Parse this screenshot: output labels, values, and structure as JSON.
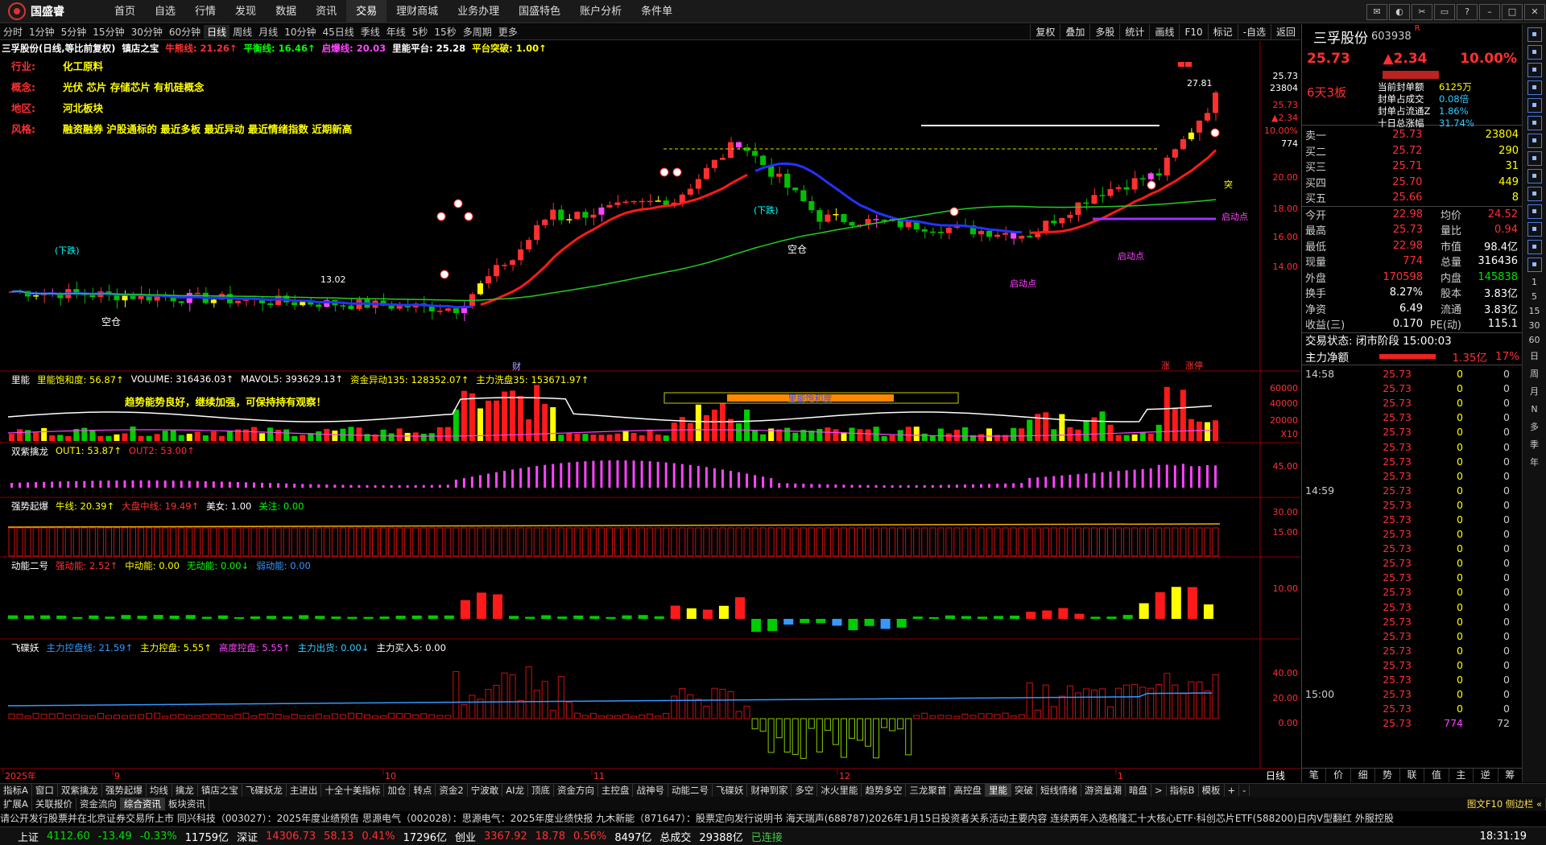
{
  "app": {
    "brand": "国盛睿",
    "menu": [
      "首页",
      "自选",
      "行情",
      "发现",
      "数据",
      "资讯",
      "交易",
      "理财商城",
      "业务办理",
      "国盛特色",
      "账户分析",
      "条件单"
    ],
    "active_menu": "交易"
  },
  "periods": [
    "分时",
    "1分钟",
    "5分钟",
    "15分钟",
    "30分钟",
    "60分钟",
    "日线",
    "周线",
    "月线",
    "10分钟",
    "45日线",
    "季线",
    "年线",
    "5秒",
    "15秒",
    "多周期",
    "更多"
  ],
  "active_period": "日线",
  "right_tools": [
    "复权",
    "叠加",
    "多股",
    "统计",
    "画线",
    "F10",
    "标记",
    "-自选",
    "返回"
  ],
  "chart": {
    "header": [
      {
        "text": "三孚股份(日线,等比前复权)",
        "color": "#ffffff"
      },
      {
        "text": "镇店之宝",
        "color": "#ffffff"
      },
      {
        "text": "牛熊线: 21.26↑",
        "color": "#ff3030"
      },
      {
        "text": "平衡线: 16.46↑",
        "color": "#00ff00"
      },
      {
        "text": "启爆线: 20.03",
        "color": "#ff44ff"
      },
      {
        "text": "里能平台: 25.28",
        "color": "#ffffff"
      },
      {
        "text": "平台突破: 1.00↑",
        "color": "#ffff00"
      }
    ],
    "info": [
      {
        "label": "行业:",
        "value": "化工原料"
      },
      {
        "label": "概念:",
        "value": "光伏 芯片 存储芯片 有机硅概念"
      },
      {
        "label": "地区:",
        "value": "河北板块"
      },
      {
        "label": "风格:",
        "value": "融资融券 沪股通标的 最近多板 最近异动 最近情绪指数 近期新高"
      }
    ],
    "price_axis": [
      "25.73",
      "23804",
      "25.73",
      "▲2.34",
      "10.00%",
      "774",
      "20.00",
      "18.00",
      "16.00",
      "14.00"
    ],
    "annotations": {
      "high": "27.81",
      "low": "13.02",
      "xiadie1": "(下跌)",
      "xiadie2": "(下跌)",
      "kongcang1": "空仓",
      "kongcang2": "空仓",
      "qidongdian": "启动点",
      "tu": "突",
      "cai": "财",
      "zhang": "涨",
      "zhangting": "涨停"
    },
    "panels": [
      {
        "title": "里能",
        "items": [
          {
            "text": "里能饱和度: 56.87↑",
            "color": "#ffff00"
          },
          {
            "text": "VOLUME: 316436.03↑",
            "color": "#ffffff"
          },
          {
            "text": "MAVOL5: 393629.13↑",
            "color": "#ffffff"
          },
          {
            "text": "资金异动135: 128352.07↑",
            "color": "#ffff00"
          },
          {
            "text": "主力洗盘35: 153671.97↑",
            "color": "#ffff00"
          }
        ],
        "axis": [
          "60000",
          "40000",
          "20000",
          "X10"
        ],
        "note": "趋势能势良好，继续加强，可保持持有观察！",
        "box": "里能饱和度"
      },
      {
        "title": "双紫擒龙",
        "items": [
          {
            "text": "OUT1: 53.87↑",
            "color": "#ffff00"
          },
          {
            "text": "OUT2: 53.00↑",
            "color": "#ff3030"
          }
        ],
        "axis": [
          "45.00"
        ]
      },
      {
        "title": "强势起爆",
        "items": [
          {
            "text": "牛线: 20.39↑",
            "color": "#ffff00"
          },
          {
            "text": "大盘中线: 19.49↑",
            "color": "#ff3030"
          },
          {
            "text": "美女: 1.00",
            "color": "#ffffff"
          },
          {
            "text": "关注: 0.00",
            "color": "#00ff00"
          }
        ],
        "axis": [
          "30.00",
          "15.00"
        ]
      },
      {
        "title": "动能二号",
        "items": [
          {
            "text": "强动能: 2.52↑",
            "color": "#ff3030"
          },
          {
            "text": "中动能: 0.00",
            "color": "#ffff00"
          },
          {
            "text": "无动能: 0.00↓",
            "color": "#00ff00"
          },
          {
            "text": "弱动能: 0.00",
            "color": "#3399ff"
          }
        ],
        "axis": [
          "10.00"
        ]
      },
      {
        "title": "飞碟妖",
        "items": [
          {
            "text": "主力控盘线: 21.59↑",
            "color": "#3399ff"
          },
          {
            "text": "主力控盘: 5.55↑",
            "color": "#ffff00"
          },
          {
            "text": "高度控盘: 5.55↑",
            "color": "#ff44ff"
          },
          {
            "text": "主力出货: 0.00↓",
            "color": "#33ccff"
          },
          {
            "text": "主力买入5: 0.00",
            "color": "#ffffff"
          }
        ],
        "axis": [
          "40.00",
          "20.00",
          "0.00"
        ]
      }
    ],
    "dates": [
      "2025年",
      "9",
      "10",
      "11",
      "12",
      "1"
    ],
    "period_label": "日线"
  },
  "quote": {
    "name": "三孚股份",
    "code": "603938",
    "mark": "R",
    "price": "25.73",
    "change": "▲2.34",
    "pct": "10.00%",
    "limit_label": "6天3板",
    "seal": [
      {
        "k": "当前封单额",
        "v": "6125万"
      },
      {
        "k": "封单占成交",
        "v": "0.08倍"
      },
      {
        "k": "封单占流通Z",
        "v": "1.86%"
      },
      {
        "k": "十日总涨幅",
        "v": "31.74%"
      }
    ],
    "book": [
      {
        "k": "卖一",
        "p": "25.73",
        "v": "23804"
      },
      {
        "k": "买二",
        "p": "25.72",
        "v": "290"
      },
      {
        "k": "买三",
        "p": "25.71",
        "v": "31"
      },
      {
        "k": "买四",
        "p": "25.70",
        "v": "449"
      },
      {
        "k": "买五",
        "p": "25.66",
        "v": "8"
      }
    ],
    "stats": [
      {
        "a": "今开",
        "b": "22.98",
        "c": "均价",
        "d": "24.52"
      },
      {
        "a": "最高",
        "b": "25.73",
        "c": "量比",
        "d": "0.94"
      },
      {
        "a": "最低",
        "b": "22.98",
        "c": "市值",
        "d": "98.4亿"
      },
      {
        "a": "现量",
        "b": "774",
        "c": "总量",
        "d": "316436"
      },
      {
        "a": "外盘",
        "b": "170598",
        "c": "内盘",
        "d": "145838"
      },
      {
        "a": "换手",
        "b": "8.27%",
        "c": "股本",
        "d": "3.83亿"
      },
      {
        "a": "净资",
        "b": "6.49",
        "c": "流通",
        "d": "3.83亿"
      },
      {
        "a": "收益(三)",
        "b": "0.170",
        "c": "PE(动)",
        "d": "115.1"
      }
    ],
    "trade_status": "交易状态: 闭市阶段 15:00:03",
    "main_flow_label": "主力净额",
    "main_flow_value": "1.35亿",
    "main_flow_pct": "17%",
    "ticks": [
      {
        "t": "14:58",
        "p": "25.73",
        "v": "0",
        "n": "0"
      },
      {
        "t": "",
        "p": "25.73",
        "v": "0",
        "n": "0"
      },
      {
        "t": "",
        "p": "25.73",
        "v": "0",
        "n": "0"
      },
      {
        "t": "",
        "p": "25.73",
        "v": "0",
        "n": "0"
      },
      {
        "t": "",
        "p": "25.73",
        "v": "0",
        "n": "0"
      },
      {
        "t": "",
        "p": "25.73",
        "v": "0",
        "n": "0"
      },
      {
        "t": "",
        "p": "25.73",
        "v": "0",
        "n": "0"
      },
      {
        "t": "",
        "p": "25.73",
        "v": "0",
        "n": "0"
      },
      {
        "t": "14:59",
        "p": "25.73",
        "v": "0",
        "n": "0"
      },
      {
        "t": "",
        "p": "25.73",
        "v": "0",
        "n": "0"
      },
      {
        "t": "",
        "p": "25.73",
        "v": "0",
        "n": "0"
      },
      {
        "t": "",
        "p": "25.73",
        "v": "0",
        "n": "0"
      },
      {
        "t": "",
        "p": "25.73",
        "v": "0",
        "n": "0"
      },
      {
        "t": "",
        "p": "25.73",
        "v": "0",
        "n": "0"
      },
      {
        "t": "",
        "p": "25.73",
        "v": "0",
        "n": "0"
      },
      {
        "t": "",
        "p": "25.73",
        "v": "0",
        "n": "0"
      },
      {
        "t": "",
        "p": "25.73",
        "v": "0",
        "n": "0"
      },
      {
        "t": "",
        "p": "25.73",
        "v": "0",
        "n": "0"
      },
      {
        "t": "",
        "p": "25.73",
        "v": "0",
        "n": "0"
      },
      {
        "t": "",
        "p": "25.73",
        "v": "0",
        "n": "0"
      },
      {
        "t": "",
        "p": "25.73",
        "v": "0",
        "n": "0"
      },
      {
        "t": "",
        "p": "25.73",
        "v": "0",
        "n": "0"
      },
      {
        "t": "15:00",
        "p": "25.73",
        "v": "0",
        "n": "0"
      },
      {
        "t": "",
        "p": "25.73",
        "v": "0",
        "n": "0"
      },
      {
        "t": "",
        "p": "25.73",
        "v": "774",
        "n": "72"
      }
    ],
    "bottom_tabs": [
      "笔",
      "价",
      "细",
      "势",
      "联",
      "值",
      "主",
      "逆",
      "筹"
    ]
  },
  "side": [
    "日",
    "周",
    "月",
    "N",
    "多",
    "季",
    "年"
  ],
  "side_nums": [
    "1",
    "5",
    "15",
    "30",
    "60"
  ],
  "tabs": [
    "指标A",
    "窗口",
    "双紫擒龙",
    "强势起爆",
    "均线",
    "擒龙",
    "镇店之宝",
    "飞碟妖龙",
    "主进出",
    "十全十美指标",
    "加仓",
    "转点",
    "资金2",
    "宁波敢",
    "AI龙",
    "顶底",
    "资金方向",
    "主控盘",
    "战神号",
    "动能二号",
    "飞碟妖",
    "财神到家",
    "多空",
    "冰火里能",
    "趋势多空",
    "三龙聚首",
    "高控盘",
    "里能",
    "突破",
    "短线情绪",
    "游资量潮",
    "暗盘",
    ">",
    "指标B",
    "模板",
    "+",
    "-"
  ],
  "active_tab": "里能",
  "subtabs": [
    "扩展A",
    "关联报价",
    "资金流向",
    "综合资讯",
    "板块资讯"
  ],
  "subtab_right": "图文F10 侧边栏 «",
  "ticker": "请公开发行股票并在北京证券交易所上市    同兴科技（003027）：2025年度业绩预告    思源电气（002028）：思源电气：2025年度业绩快报    九木新能（871647）：股票定向发行说明书    海天瑞声(688787)2026年1月15日投资者关系活动主要内容    连续两年入选格隆汇十大核心ETF·科创芯片ETF(588200)日内V型翻红    外服控股",
  "status": {
    "sh_label": "上证",
    "sh": "4112.60",
    "sh_chg": "-13.49",
    "sh_pct": "-0.33%",
    "sh_amt": "11759亿",
    "sz_label": "深证",
    "sz": "14306.73",
    "sz_chg": "58.13",
    "sz_pct": "0.41%",
    "sz_amt": "17296亿",
    "cy_label": "创业",
    "cy": "3367.92",
    "cy_chg": "18.78",
    "cy_pct": "0.56%",
    "cy_amt": "8497亿",
    "total_label": "总成交",
    "total": "29388亿",
    "conn": "已连接",
    "time": "18:31:19"
  }
}
